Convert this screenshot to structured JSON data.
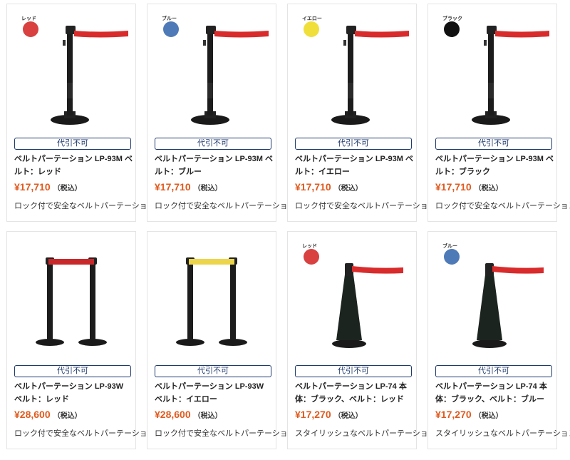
{
  "products": [
    {
      "badge": "代引不可",
      "name": "ベルトパーテーション LP-93M ベルト：レッド",
      "price": "¥17,710",
      "tax": "（税込）",
      "desc": "ロック付で安全なベルトパーテーション",
      "swatch_label": "レッド",
      "swatch_color": "#d94040",
      "belt_color": "#d92b2b",
      "stand": "single"
    },
    {
      "badge": "代引不可",
      "name": "ベルトパーテーション LP-93M ベルト：ブルー",
      "price": "¥17,710",
      "tax": "（税込）",
      "desc": "ロック付で安全なベルトパーテーション",
      "swatch_label": "ブルー",
      "swatch_color": "#4f7ab8",
      "belt_color": "#d92b2b",
      "stand": "single"
    },
    {
      "badge": "代引不可",
      "name": "ベルトパーテーション LP-93M ベルト：イエロー",
      "price": "¥17,710",
      "tax": "（税込）",
      "desc": "ロック付で安全なベルトパーテーション",
      "swatch_label": "イエロー",
      "swatch_color": "#f0df3a",
      "belt_color": "#d92b2b",
      "stand": "single"
    },
    {
      "badge": "代引不可",
      "name": "ベルトパーテーション LP-93M ベルト：ブラック",
      "price": "¥17,710",
      "tax": "（税込）",
      "desc": "ロック付で安全なベルトパーテーション",
      "swatch_label": "ブラック",
      "swatch_color": "#111111",
      "belt_color": "#d92b2b",
      "stand": "single"
    },
    {
      "badge": "代引不可",
      "name": "ベルトパーテーション LP-93W ベルト：レッド",
      "price": "¥28,600",
      "tax": "（税込）",
      "desc": "ロック付で安全なベルトパーテーション",
      "swatch_label": "",
      "swatch_color": "",
      "belt_color": "#c8282a",
      "stand": "double"
    },
    {
      "badge": "代引不可",
      "name": "ベルトパーテーション LP-93W ベルト：イエロー",
      "price": "¥28,600",
      "tax": "（税込）",
      "desc": "ロック付で安全なベルトパーテーション",
      "swatch_label": "",
      "swatch_color": "",
      "belt_color": "#ecd54a",
      "stand": "double"
    },
    {
      "badge": "代引不可",
      "name": "ベルトパーテーション LP-74 本体：ブラック、ベルト：レッド",
      "price": "¥17,270",
      "tax": "（税込）",
      "desc": "スタイリッシュなベルトパーテーション",
      "swatch_label": "レッド",
      "swatch_color": "#d94040",
      "belt_color": "#d92b2b",
      "stand": "cone"
    },
    {
      "badge": "代引不可",
      "name": "ベルトパーテーション LP-74 本体：ブラック、ベルト：ブルー",
      "price": "¥17,270",
      "tax": "（税込）",
      "desc": "スタイリッシュなベルトパーテーション",
      "swatch_label": "ブルー",
      "swatch_color": "#4f7ab8",
      "belt_color": "#d92b2b",
      "stand": "cone"
    }
  ]
}
